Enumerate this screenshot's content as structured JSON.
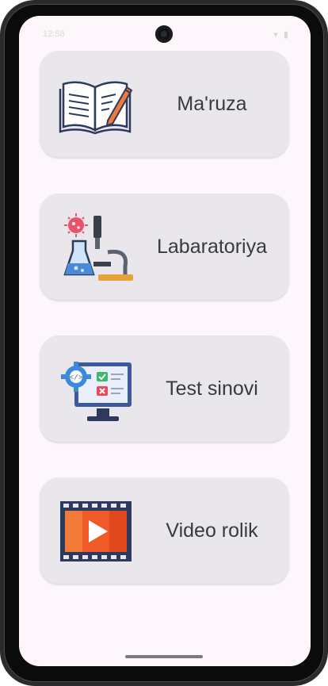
{
  "status_bar": {
    "time": "12:58",
    "icons": "▾ ▮"
  },
  "menu": {
    "items": [
      {
        "label": "Ma'ruza",
        "icon": "book-pencil-icon"
      },
      {
        "label": "Labaratoriya",
        "icon": "microscope-flask-icon"
      },
      {
        "label": "Test sinovi",
        "icon": "monitor-test-icon"
      },
      {
        "label": "Video rolik",
        "icon": "video-film-icon"
      }
    ]
  }
}
